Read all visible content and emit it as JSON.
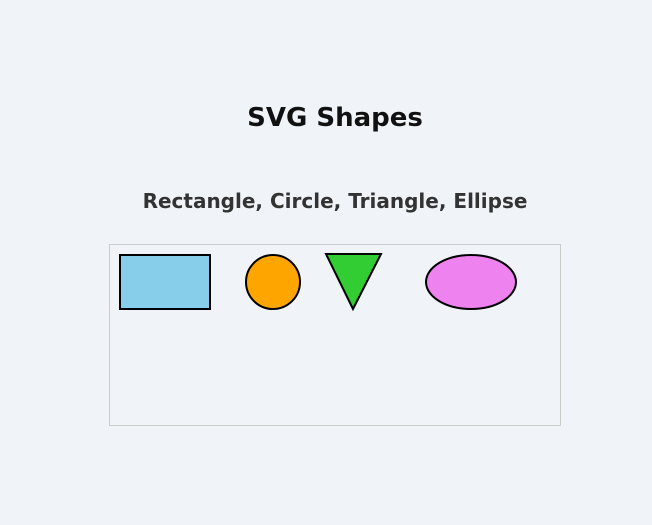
{
  "page": {
    "title": "SVG Shapes",
    "subtitle": "Rectangle, Circle, Triangle, Ellipse"
  },
  "shapes": {
    "rectangle": {
      "fill": "#87ceeb",
      "stroke": "#000000"
    },
    "circle": {
      "fill": "#ffa500",
      "stroke": "#000000"
    },
    "triangle": {
      "fill": "#32cd32",
      "stroke": "#000000"
    },
    "ellipse": {
      "fill": "#ee82ee",
      "stroke": "#000000"
    }
  }
}
